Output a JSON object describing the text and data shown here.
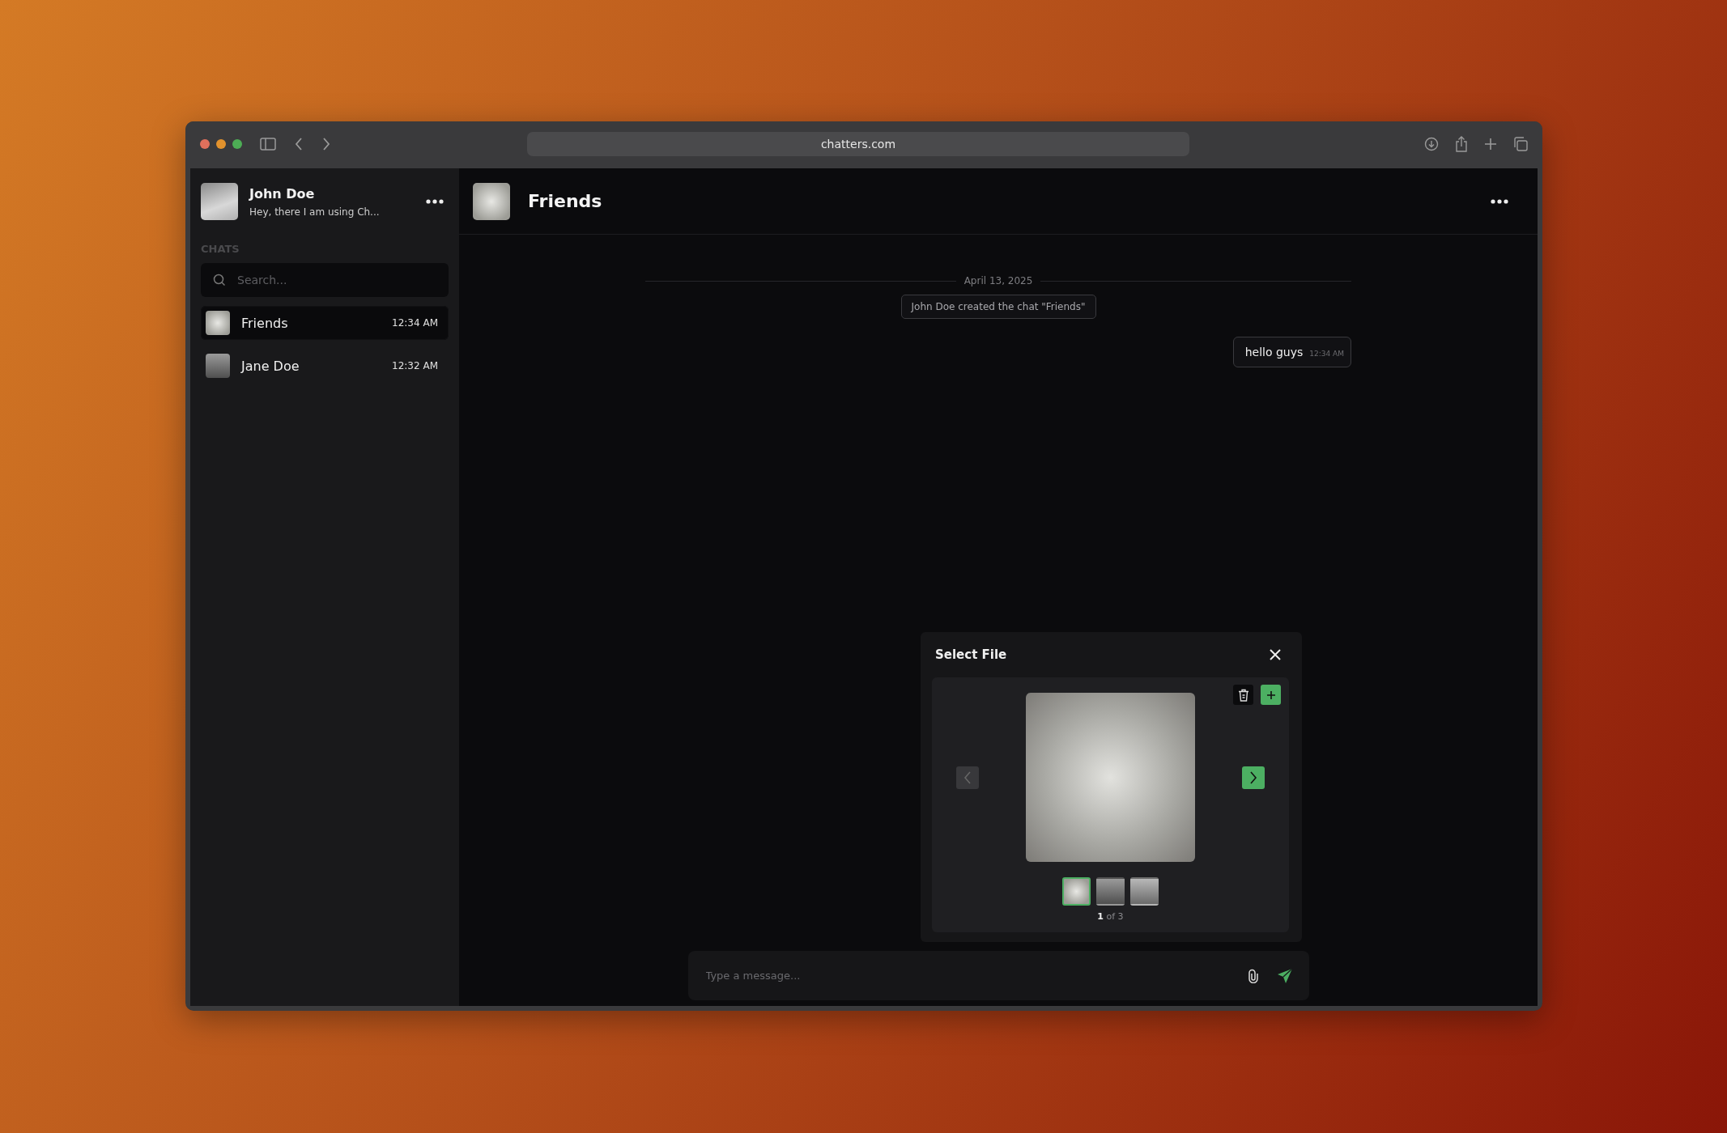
{
  "browser": {
    "url": "chatters.com"
  },
  "sidebar": {
    "profile": {
      "name": "John Doe",
      "status": "Hey, there I am using Ch..."
    },
    "section_label": "CHATS",
    "search": {
      "placeholder": "Search..."
    },
    "chats": [
      {
        "name": "Friends",
        "time": "12:34 AM",
        "selected": true
      },
      {
        "name": "Jane Doe",
        "time": "12:32 AM",
        "selected": false
      }
    ]
  },
  "chat": {
    "title": "Friends",
    "date_divider": "April 13, 2025",
    "messages": [
      {
        "kind": "system",
        "text": "John Doe created the chat \"Friends\""
      },
      {
        "kind": "outgoing",
        "text": "hello guys",
        "time": "12:34 AM"
      }
    ],
    "composer": {
      "placeholder": "Type a message..."
    }
  },
  "file_dialog": {
    "title": "Select File",
    "prev_disabled": true,
    "next_disabled": false,
    "thumbnails": [
      {
        "selected": true
      },
      {
        "selected": false
      },
      {
        "selected": false
      }
    ],
    "counter": "**1** of 3"
  }
}
